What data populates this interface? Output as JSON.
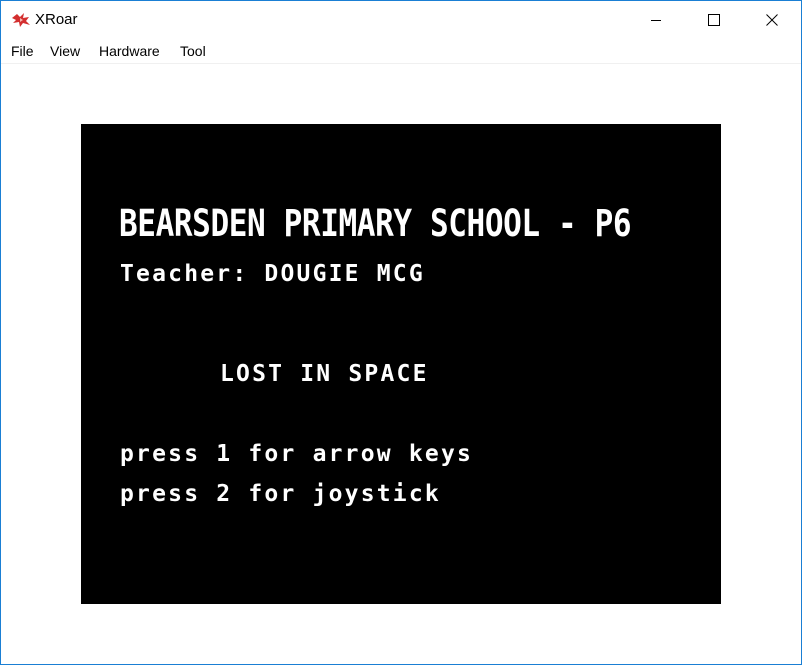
{
  "window": {
    "title": "XRoar",
    "accent_color": "#1a7fd4",
    "icon": "xroar-dragon-icon"
  },
  "menu": {
    "items": [
      "File",
      "View",
      "Hardware",
      "Tool"
    ]
  },
  "screen": {
    "background": "#000000",
    "foreground": "#ffffff",
    "title_line": "BEARSDEN PRIMARY SCHOOL - P6",
    "teacher_line": "Teacher: DOUGIE MCG",
    "game_title": "LOST IN SPACE",
    "option_1": "press 1 for arrow keys",
    "option_2": "press 2 for joystick"
  }
}
